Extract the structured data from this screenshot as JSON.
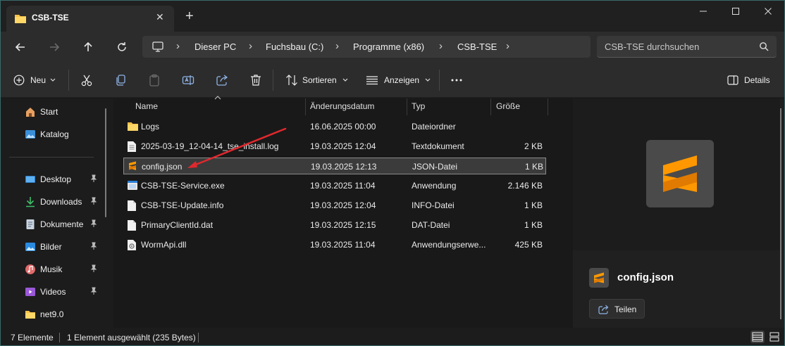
{
  "tabs": [
    {
      "title": "CSB-TSE"
    }
  ],
  "address": {
    "crumbs": [
      "Dieser PC",
      "Fuchsbau (C:)",
      "Programme (x86)",
      "CSB-TSE"
    ],
    "search_placeholder": "CSB-TSE durchsuchen"
  },
  "commands": {
    "new_label": "Neu",
    "sort_label": "Sortieren",
    "view_label": "Anzeigen",
    "details_label": "Details"
  },
  "sidebar": {
    "items": [
      {
        "label": "Start",
        "icon": "home-icon",
        "pinned": false
      },
      {
        "label": "Katalog",
        "icon": "gallery-icon",
        "pinned": false
      },
      {
        "label": "Desktop",
        "icon": "desktop-icon",
        "pinned": true
      },
      {
        "label": "Downloads",
        "icon": "downloads-icon",
        "pinned": true
      },
      {
        "label": "Dokumente",
        "icon": "documents-icon",
        "pinned": true
      },
      {
        "label": "Bilder",
        "icon": "pictures-icon",
        "pinned": true
      },
      {
        "label": "Musik",
        "icon": "music-icon",
        "pinned": true
      },
      {
        "label": "Videos",
        "icon": "videos-icon",
        "pinned": true
      },
      {
        "label": "net9.0",
        "icon": "folder-icon",
        "pinned": false
      }
    ]
  },
  "file_list": {
    "columns": {
      "name": "Name",
      "date": "Änderungsdatum",
      "type": "Typ",
      "size": "Größe"
    },
    "rows": [
      {
        "name": "Logs",
        "date": "16.06.2025 00:00",
        "type": "Dateiordner",
        "size": "",
        "icon": "folder-icon",
        "selected": false
      },
      {
        "name": "2025-03-19_12-04-14_tse_install.log",
        "date": "19.03.2025 12:04",
        "type": "Textdokument",
        "size": "2 KB",
        "icon": "text-file-icon",
        "selected": false
      },
      {
        "name": "config.json",
        "date": "19.03.2025 12:13",
        "type": "JSON-Datei",
        "size": "1 KB",
        "icon": "sublime-text-icon",
        "selected": true
      },
      {
        "name": "CSB-TSE-Service.exe",
        "date": "19.03.2025 11:04",
        "type": "Anwendung",
        "size": "2.146 KB",
        "icon": "exe-icon",
        "selected": false
      },
      {
        "name": "CSB-TSE-Update.info",
        "date": "19.03.2025 12:04",
        "type": "INFO-Datei",
        "size": "1 KB",
        "icon": "file-icon",
        "selected": false
      },
      {
        "name": "PrimaryClientId.dat",
        "date": "19.03.2025 12:15",
        "type": "DAT-Datei",
        "size": "1 KB",
        "icon": "file-icon",
        "selected": false
      },
      {
        "name": "WormApi.dll",
        "date": "19.03.2025 11:04",
        "type": "Anwendungserwe...",
        "size": "425 KB",
        "icon": "dll-icon",
        "selected": false
      }
    ]
  },
  "details_pane": {
    "file_name": "config.json",
    "share_label": "Teilen"
  },
  "status": {
    "item_count": "7 Elemente",
    "selection": "1 Element ausgewählt (235 Bytes)"
  },
  "colors": {
    "accent_orange": "#ff9800",
    "folder_yellow": "#f5c04a",
    "annotation_red": "#e0282e"
  }
}
